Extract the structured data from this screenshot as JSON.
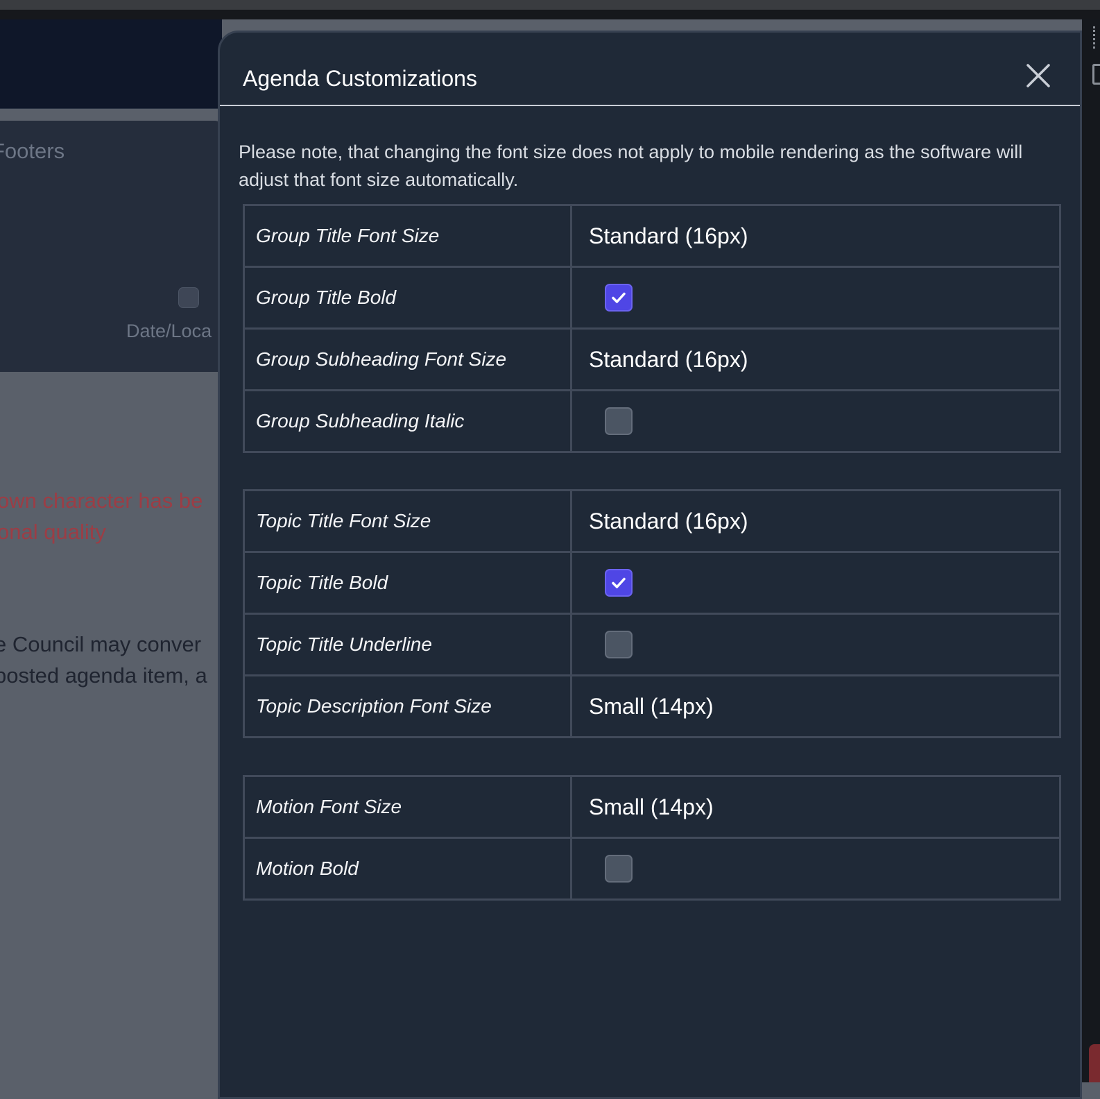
{
  "background": {
    "panel_title": "Footers",
    "date_label": "Date/Loca",
    "red_line_1": "own character has be",
    "red_line_2": "onal quality",
    "dark_line_1": "e Council may conver",
    "dark_line_2": "posted agenda item, a"
  },
  "modal": {
    "title": "Agenda Customizations",
    "close_icon": "close-icon",
    "note": "Please note, that changing the font size does not apply to mobile rendering as the software will adjust that font size automatically.",
    "group_settings": [
      {
        "label": "Group Title Font Size",
        "value": "Standard (16px)"
      },
      {
        "label": "Group Title Bold",
        "checked": true
      },
      {
        "label": "Group Subheading Font Size",
        "value": "Standard (16px)"
      },
      {
        "label": "Group Subheading Italic",
        "checked": false
      }
    ],
    "topic_settings": [
      {
        "label": "Topic Title Font Size",
        "value": "Standard (16px)"
      },
      {
        "label": "Topic Title Bold",
        "checked": true
      },
      {
        "label": "Topic Title Underline",
        "checked": false
      },
      {
        "label": "Topic Description Font Size",
        "value": "Small (14px)"
      }
    ],
    "motion_settings": [
      {
        "label": "Motion Font Size",
        "value": "Small (14px)"
      },
      {
        "label": "Motion Bold",
        "checked": false
      }
    ]
  },
  "colors": {
    "modal_bg": "#1f2937",
    "checkbox_checked": "#4f46e5",
    "checkbox_unchecked": "#4b5563"
  }
}
